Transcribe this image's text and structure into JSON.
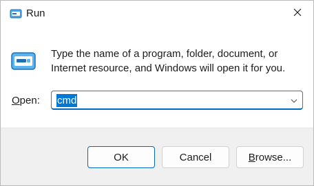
{
  "window": {
    "title": "Run",
    "icon": "run-icon",
    "close_icon": "close-icon"
  },
  "content": {
    "icon": "run-app-icon",
    "description": "Type the name of a program, folder, document, or Internet resource, and Windows will open it for you.",
    "open_label_prefix": "",
    "open_label_mnemonic": "O",
    "open_label_rest": "pen:",
    "open_value": "cmd",
    "dropdown_icon": "chevron-down-icon"
  },
  "buttons": {
    "ok": "OK",
    "cancel": "Cancel",
    "browse_mnemonic": "B",
    "browse_rest": "rowse..."
  },
  "colors": {
    "accent": "#0067c0",
    "selection": "#0078d4",
    "footer_bg": "#f0f0f0"
  }
}
